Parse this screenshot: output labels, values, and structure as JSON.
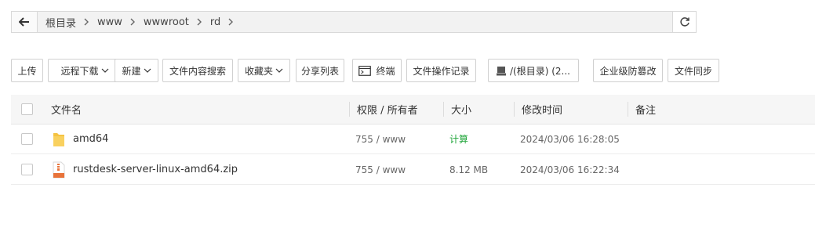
{
  "breadcrumb": {
    "items": [
      "根目录",
      "www",
      "wwwroot",
      "rd"
    ]
  },
  "toolbar": {
    "upload": "上传",
    "remote_download": "远程下载",
    "new": "新建",
    "content_search": "文件内容搜索",
    "favorites": "收藏夹",
    "share_list": "分享列表",
    "terminal": "终端",
    "file_log": "文件操作记录",
    "disk": "/(根目录) (2...",
    "tamper_protect": "企业级防篡改",
    "file_sync": "文件同步"
  },
  "table": {
    "columns": [
      "文件名",
      "权限 / 所有者",
      "大小",
      "修改时间",
      "备注"
    ],
    "rows": [
      {
        "name": "amd64",
        "perm": "755 / www",
        "size": "计算",
        "mtime": "2024/03/06 16:28:05",
        "note": "",
        "type": "folder"
      },
      {
        "name": "rustdesk-server-linux-amd64.zip",
        "perm": "755 / www",
        "size": "8.12 MB",
        "mtime": "2024/03/06 16:22:34",
        "note": "",
        "type": "zip"
      }
    ]
  },
  "colors": {
    "accent_green": "#20a53a",
    "folder": "#f5c342",
    "zip": "#e8733a"
  }
}
